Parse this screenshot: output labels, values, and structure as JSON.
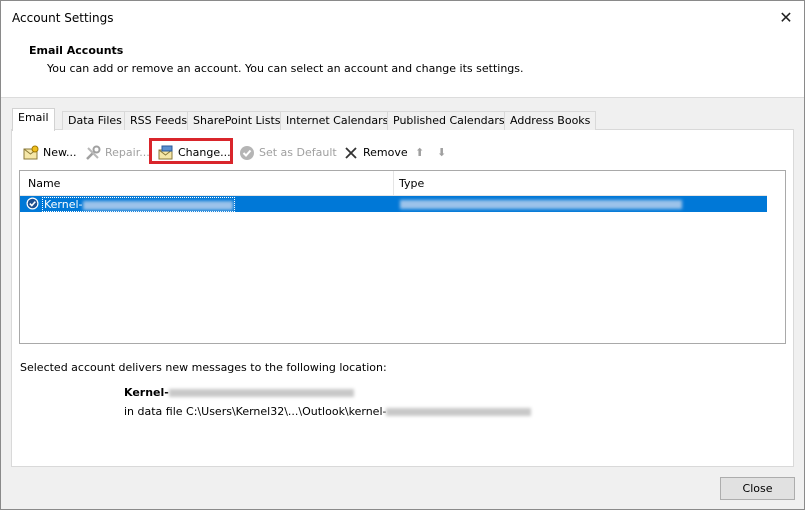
{
  "window": {
    "title": "Account Settings",
    "close_glyph": "✕"
  },
  "header": {
    "title": "Email Accounts",
    "description": "You can add or remove an account. You can select an account and change its settings."
  },
  "tabs": [
    {
      "label": "Email"
    },
    {
      "label": "Data Files"
    },
    {
      "label": "RSS Feeds"
    },
    {
      "label": "SharePoint Lists"
    },
    {
      "label": "Internet Calendars"
    },
    {
      "label": "Published Calendars"
    },
    {
      "label": "Address Books"
    }
  ],
  "toolbar": {
    "new_label": "New...",
    "repair_label": "Repair...",
    "change_label": "Change...",
    "set_default_label": "Set as Default",
    "remove_label": "Remove",
    "move_up_glyph": "⬆",
    "move_down_glyph": "⬇"
  },
  "accounts": {
    "columns": [
      "Name",
      "Type"
    ],
    "rows": [
      {
        "name": "Kernel-",
        "selected": true
      }
    ]
  },
  "location": {
    "caption": "Selected account delivers new messages to the following location:",
    "account_prefix": "Kernel-",
    "data_file_prefix": "in data file C:\\Users\\Kernel32\\...\\Outlook\\kernel-"
  },
  "footer": {
    "close_label": "Close"
  },
  "colors": {
    "selection": "#0078d7",
    "highlight_box": "#d9252b"
  }
}
